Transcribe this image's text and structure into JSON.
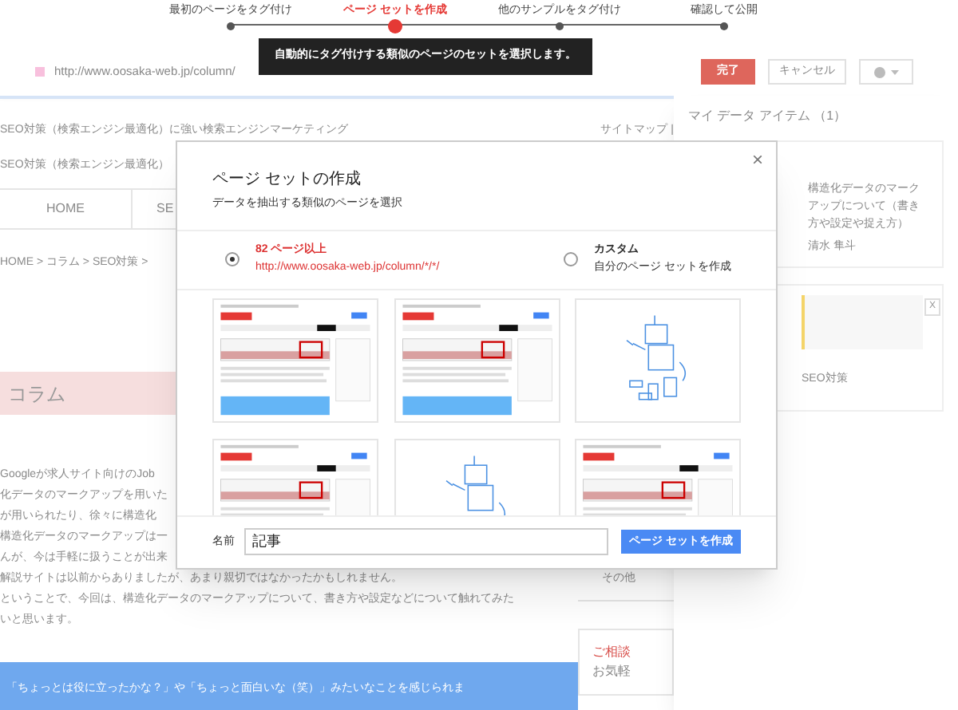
{
  "stepper": {
    "steps": [
      {
        "label": "最初のページをタグ付け",
        "selected": false
      },
      {
        "label": "ページ セットを作成",
        "selected": true
      },
      {
        "label": "他のサンプルをタグ付け",
        "selected": false
      },
      {
        "label": "確認して公開",
        "selected": false
      }
    ],
    "tooltip": "自動的にタグ付けする類似のページのセットを選択します。"
  },
  "toolbar": {
    "url": "http://www.oosaka-web.jp/column/",
    "buttons": [
      {
        "label": "完了",
        "kind": "primary"
      },
      {
        "label": "キャンセル",
        "kind": "secondary"
      }
    ]
  },
  "page": {
    "tagline": "SEO対策（検索エンジン最適化）に強い検索エンジンマーケティング",
    "sitemap_link": "サイトマップ |",
    "logo_text": "SEO対策（検索エンジン最適化）",
    "nav": [
      "HOME",
      "SE"
    ],
    "breadcrumb": "HOME > コラム > SEO対策 >",
    "section_title": "コラム",
    "paragraph_lines": [
      "Googleが求人サイト向けのJob",
      "化データのマークアップを用いた",
      "が用いられたり、徐々に構造化",
      "構造化データのマークアップは一",
      "んが、今は手軽に扱うことが出来",
      "解説サイトは以前からありましたが、あまり親切ではなかったかもしれません。",
      "ということで、今回は、構造化データのマークアップについて、書き方や設定などについて触れてみた",
      "いと思います。"
    ],
    "callout": "「ちょっとは役に立ったかな？」や「ちょっと面白いな（笑）」みたいなことを感じられま",
    "side_other": "その他",
    "side_contact_title": "ご相談",
    "side_contact_text": "お気軽"
  },
  "data_items": {
    "title": "マイ データ アイテム （1）",
    "items": [
      {
        "kind": "article",
        "title": "構造化データのマークアップについて（書き方や設定や捉え方）",
        "author": "清水 隼斗"
      },
      {
        "kind": "thumbnail",
        "remove": "X",
        "category": "SEO対策"
      }
    ]
  },
  "dialog": {
    "close": "×",
    "title": "ページ セットの作成",
    "subtitle": "データを抽出する類似のページを選択",
    "options": [
      {
        "title": "82 ページ以上",
        "detail": "http://www.oosaka-web.jp/column/*/*/",
        "selected": true
      },
      {
        "title": "カスタム",
        "detail": "自分のページ セットを作成",
        "selected": false
      }
    ],
    "thumbnails": [
      {
        "kind": "page"
      },
      {
        "kind": "page"
      },
      {
        "kind": "robot"
      },
      {
        "kind": "page"
      },
      {
        "kind": "robot"
      },
      {
        "kind": "page"
      }
    ],
    "name_label": "名前",
    "name_value": "記事",
    "submit": "ページ セットを作成"
  }
}
